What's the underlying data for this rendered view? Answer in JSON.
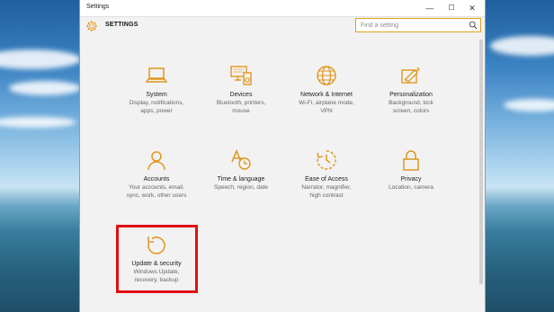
{
  "window": {
    "title": "Settings",
    "controls": {
      "minimize": "—",
      "maximize": "☐",
      "close": "✕"
    }
  },
  "header": {
    "heading": "SETTINGS",
    "search_placeholder": "Find a setting"
  },
  "accent_color": "#e0961e",
  "highlight_color": "#e01010",
  "tiles": [
    {
      "icon": "laptop-icon",
      "name": "System",
      "desc": "Display, notifications,\napps, power"
    },
    {
      "icon": "devices-icon",
      "name": "Devices",
      "desc": "Bluetooth, printers,\nmouse"
    },
    {
      "icon": "globe-icon",
      "name": "Network & Internet",
      "desc": "Wi-Fi, airplane mode,\nVPN"
    },
    {
      "icon": "personalization-icon",
      "name": "Personalization",
      "desc": "Background, lock\nscreen, colors"
    },
    {
      "icon": "person-icon",
      "name": "Accounts",
      "desc": "Your accounts, email,\nsync, work, other users"
    },
    {
      "icon": "time-language-icon",
      "name": "Time & language",
      "desc": "Speech, region, date"
    },
    {
      "icon": "ease-of-access-icon",
      "name": "Ease of Access",
      "desc": "Narrator, magnifier,\nhigh contrast"
    },
    {
      "icon": "lock-icon",
      "name": "Privacy",
      "desc": "Location, camera"
    },
    {
      "icon": "update-icon",
      "name": "Update & security",
      "desc": "Windows Update,\nrecovery, backup"
    }
  ]
}
